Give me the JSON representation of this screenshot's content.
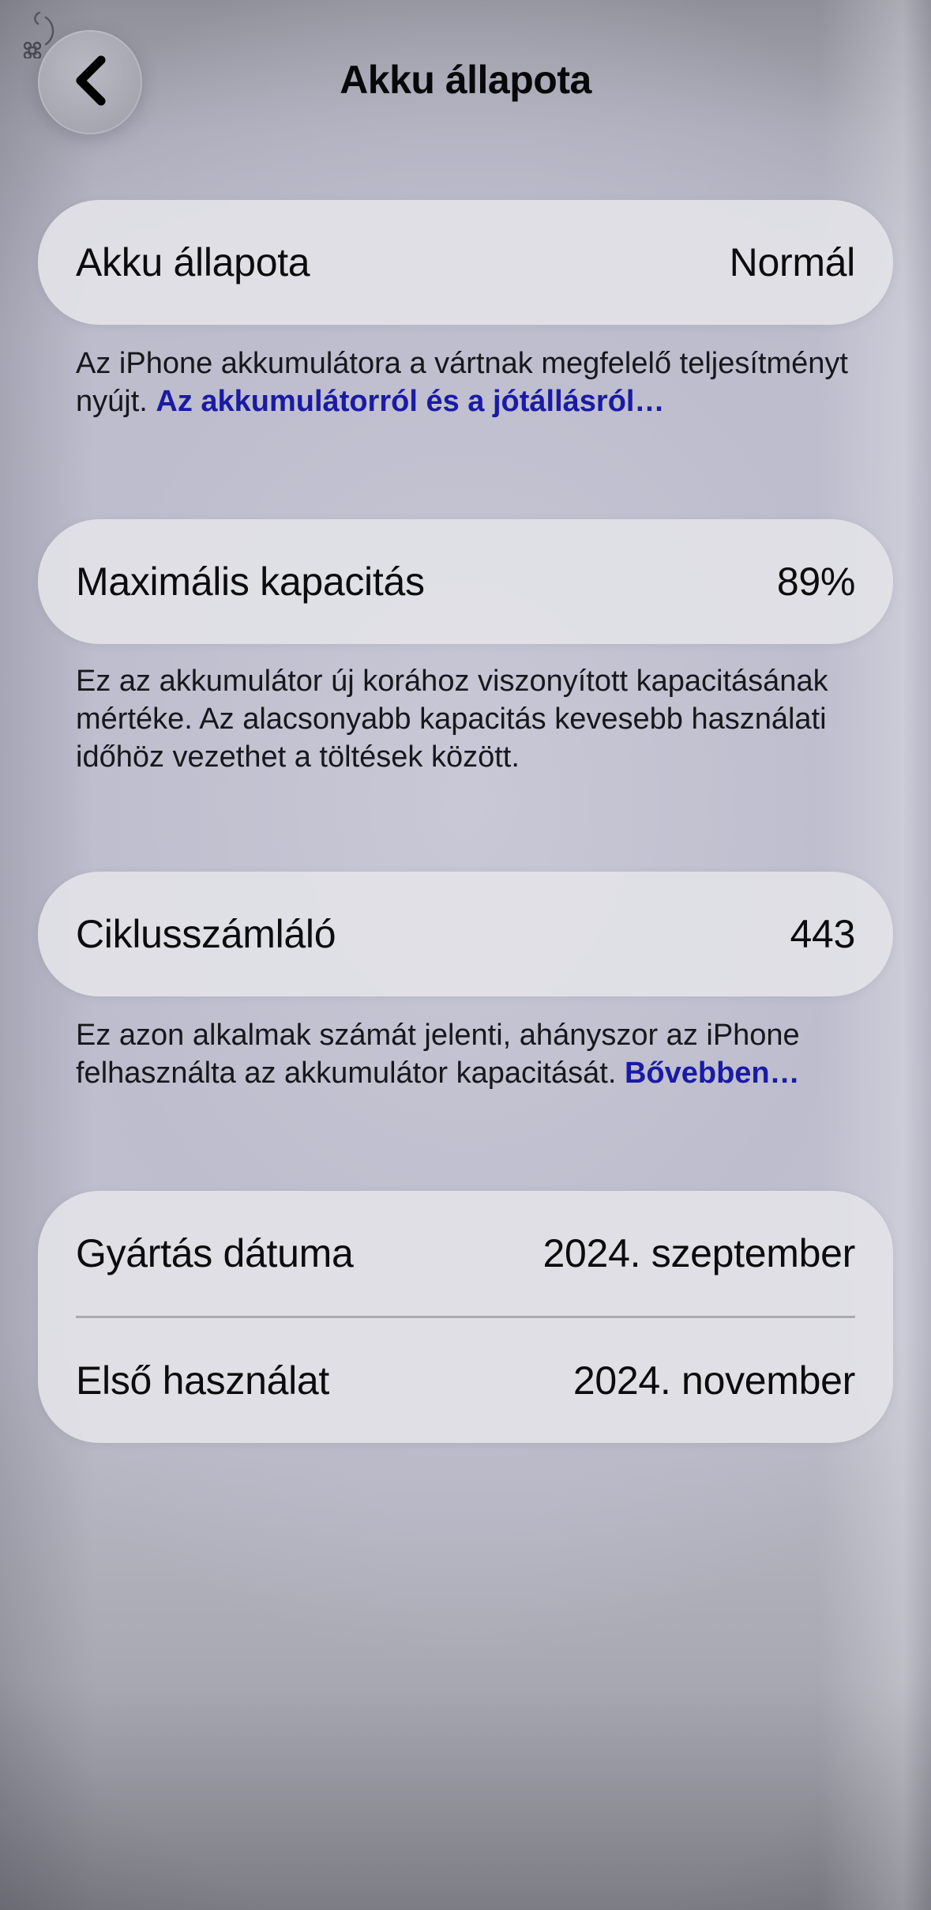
{
  "header": {
    "title": "Akku állapota",
    "back_icon": "chevron-left-icon"
  },
  "battery_health": {
    "label": "Akku állapota",
    "value": "Normál",
    "note_text": "Az iPhone akkumulátora a vártnak megfelelő teljesítményt nyújt.",
    "note_link": "Az akkumulátorról és a jótállásról…"
  },
  "max_capacity": {
    "label": "Maximális kapacitás",
    "value": "89%",
    "note_text": "Ez az akkumulátor új korához viszonyított kapacitásának mértéke. Az alacsonyabb kapacitás kevesebb használati időhöz vezethet a töltések között."
  },
  "cycle_count": {
    "label": "Ciklusszámláló",
    "value": "443",
    "note_text": "Ez azon alkalmak számát jelenti, ahányszor az iPhone felhasználta az akkumulátor kapacitását.",
    "note_link": "Bővebben…"
  },
  "dates": {
    "manufacture_label": "Gyártás dátuma",
    "manufacture_value": "2024. szeptember",
    "first_use_label": "Első használat",
    "first_use_value": "2024. november"
  },
  "colors": {
    "link": "#1a1aa6",
    "card": "#e2e2e7",
    "text": "#111114"
  }
}
